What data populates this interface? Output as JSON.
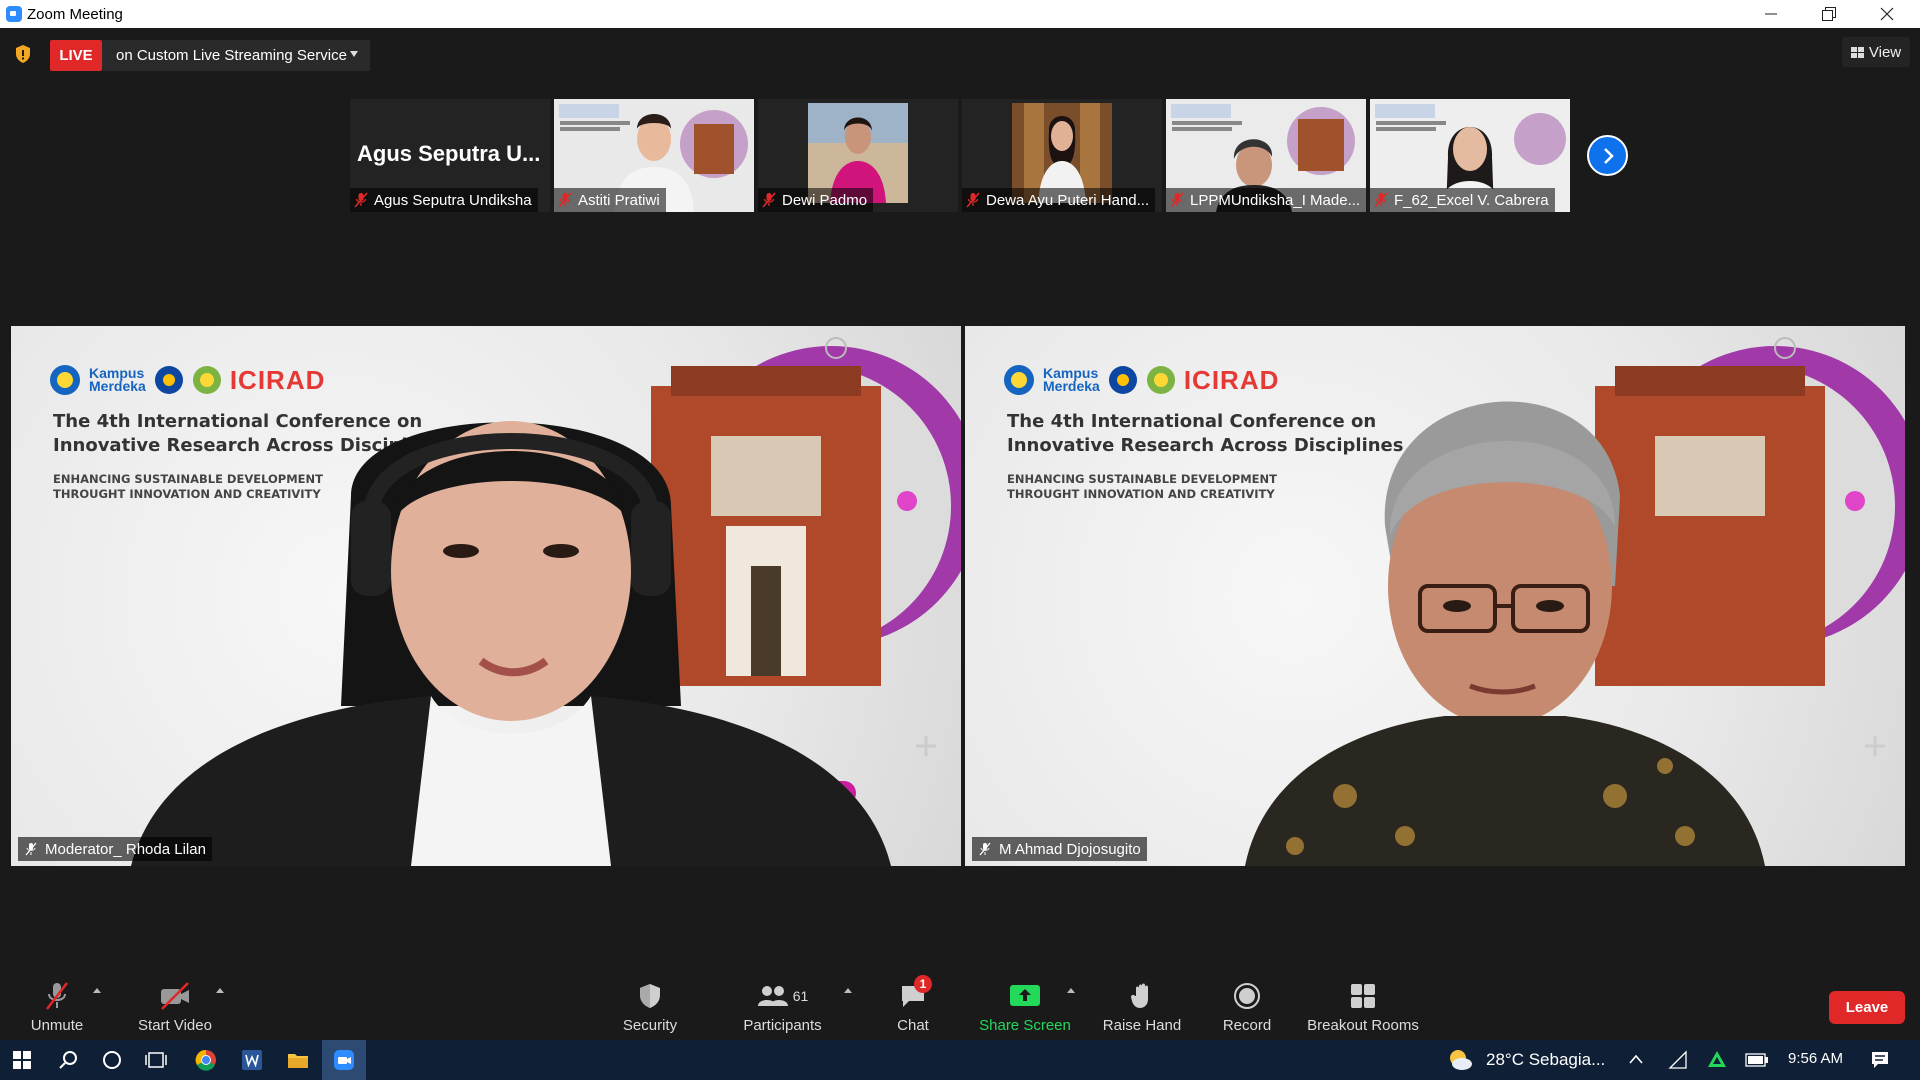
{
  "window": {
    "title": "Zoom Meeting",
    "controls": [
      "minimize",
      "restore",
      "close"
    ]
  },
  "meeting_bar": {
    "live_label": "LIVE",
    "stream_label": "on Custom Live Streaming Service",
    "view_label": "View"
  },
  "thumbnails": [
    {
      "name": "Agus Seputra Undiksha",
      "display_text": "Agus Seputra U...",
      "video": false,
      "muted": true
    },
    {
      "name": "Astiti Pratiwi",
      "video": true,
      "muted": true
    },
    {
      "name": "Dewi Padmo",
      "video": true,
      "muted": true
    },
    {
      "name": "Dewa Ayu Puteri Hand...",
      "video": true,
      "muted": true
    },
    {
      "name": "LPPMUndiksha_I Made...",
      "video": true,
      "muted": true
    },
    {
      "name": "F_62_Excel V. Cabrera",
      "video": true,
      "muted": true
    }
  ],
  "conference_slide": {
    "brand1": "Kampus",
    "brand2": "Merdeka",
    "event_logo": "ICIRAD",
    "title_line1": "The 4th International Conference on",
    "title_line2": "Innovative Research Across Disciplines",
    "subtitle_line1": "ENHANCING SUSTAINABLE DEVELOPMENT",
    "subtitle_line2": "THROUGHT INNOVATION AND CREATIVITY"
  },
  "main_tiles": [
    {
      "name": "Moderator_ Rhoda Lilan",
      "active_speaker": true
    },
    {
      "name": "M Ahmad Djojosugito",
      "active_speaker": false
    }
  ],
  "toolbar": {
    "unmute": "Unmute",
    "start_video": "Start Video",
    "security": "Security",
    "participants": "Participants",
    "participants_count": "61",
    "chat": "Chat",
    "chat_badge": "1",
    "share_screen": "Share Screen",
    "raise_hand": "Raise Hand",
    "record": "Record",
    "breakout_rooms": "Breakout Rooms",
    "leave": "Leave"
  },
  "taskbar": {
    "weather": "28°C  Sebagia...",
    "time": "9:56 AM",
    "icons": [
      "windows-start",
      "search",
      "cortana",
      "task-view",
      "chrome",
      "word",
      "file-explorer",
      "zoom"
    ]
  },
  "colors": {
    "live": "#e02828",
    "active_speaker": "#d7e91a",
    "share_green": "#23d959",
    "accent_blue": "#0e72ed"
  }
}
